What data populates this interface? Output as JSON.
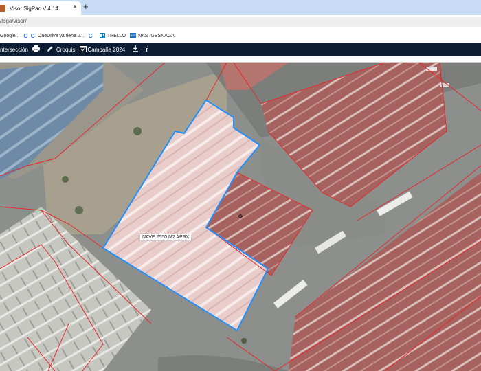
{
  "browser": {
    "tab": {
      "title": "Visor SigPac V 4.14",
      "close": "×"
    },
    "new_tab": "+",
    "address": "/lega/visor/",
    "bookmarks": [
      {
        "label": "Google...",
        "icon": "google-icon"
      },
      {
        "label": "OneDrive ya tiene u...",
        "icon": "google-icon"
      },
      {
        "label": "",
        "icon": "google-icon"
      },
      {
        "label": "TRELLO",
        "icon": "trello-icon"
      },
      {
        "label": "NAS_GESNAGA",
        "icon": "nas-icon"
      }
    ]
  },
  "toolbar": {
    "interseccion": "ntersección",
    "croquis": "Croquis",
    "campana": "Campaña 2024",
    "info": "i"
  },
  "map": {
    "parcel_label": "NAVE 2550 M2 APRX",
    "colors": {
      "parcel_outline": "#1e90ff",
      "boundary": "#e8262b",
      "roof": "#a8605e"
    }
  }
}
